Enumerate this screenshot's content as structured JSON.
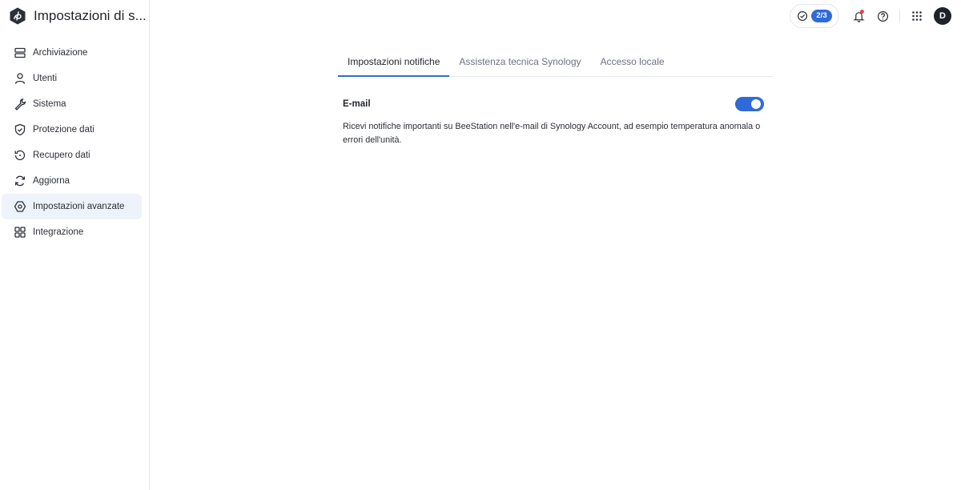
{
  "app": {
    "title": "Impostazioni di s...",
    "logo_icon": "beestation-logo-icon"
  },
  "sidebar": {
    "items": [
      {
        "label": "Archiviazione",
        "icon": "storage-icon"
      },
      {
        "label": "Utenti",
        "icon": "user-icon"
      },
      {
        "label": "Sistema",
        "icon": "wrench-icon"
      },
      {
        "label": "Protezione dati",
        "icon": "shield-check-icon"
      },
      {
        "label": "Recupero dati",
        "icon": "restore-icon"
      },
      {
        "label": "Aggiorna",
        "icon": "refresh-icon"
      },
      {
        "label": "Impostazioni avanzate",
        "icon": "hexagon-gear-icon",
        "active": true
      },
      {
        "label": "Integrazione",
        "icon": "grid-apps-icon"
      }
    ]
  },
  "topbar": {
    "tasks_badge": "2/3",
    "user_initial": "D"
  },
  "tabs": [
    {
      "label": "Impostazioni notifiche",
      "active": true
    },
    {
      "label": "Assistenza tecnica Synology",
      "active": false
    },
    {
      "label": "Accesso locale",
      "active": false
    }
  ],
  "email_setting": {
    "title": "E-mail",
    "enabled": true,
    "description": "Ricevi notifiche importanti su BeeStation nell'e-mail di Synology Account, ad esempio temperatura anomala o errori dell'unità."
  },
  "colors": {
    "accent": "#2f6bd8",
    "active_nav_bg": "#eef3fb",
    "notification_dot": "#e5484d"
  }
}
